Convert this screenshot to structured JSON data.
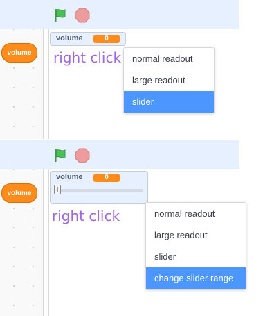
{
  "top": {
    "palette_variable": "volume",
    "monitor": {
      "label": "volume",
      "value": "0"
    },
    "hint_text": "right click",
    "context_menu": {
      "items": [
        {
          "label": "normal readout"
        },
        {
          "label": "large readout"
        },
        {
          "label": "slider"
        }
      ],
      "highlighted": "slider"
    }
  },
  "bottom": {
    "palette_variable": "volume",
    "monitor": {
      "label": "volume",
      "value": "0",
      "slider_value": 0
    },
    "hint_text": "right click",
    "context_menu": {
      "items": [
        {
          "label": "normal readout"
        },
        {
          "label": "large readout"
        },
        {
          "label": "slider"
        },
        {
          "label": "change slider range"
        }
      ],
      "highlighted": "change slider range"
    }
  },
  "colors": {
    "accent": "#4c97ff",
    "variable": "#ff8c1a",
    "hint_text": "#a066e6",
    "flag": "#4cbf56",
    "stop": "#ec9c9c"
  },
  "icons": [
    "green-flag-icon",
    "stop-icon"
  ]
}
